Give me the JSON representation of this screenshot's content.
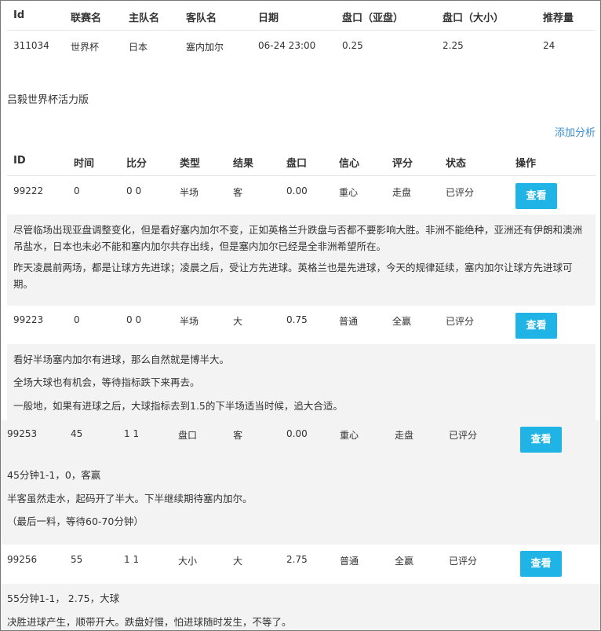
{
  "match_table": {
    "headers": [
      "Id",
      "联赛名",
      "主队名",
      "客队名",
      "日期",
      "盘口（亚盘）",
      "盘口（大小）",
      "推荐量"
    ],
    "row": [
      "311034",
      "世界杯",
      "日本",
      "塞内加尔",
      "06-24 23:00",
      "0.25",
      "2.25",
      "24"
    ]
  },
  "section_title": "吕毅世界杯活力版",
  "add_analysis": "添加分析",
  "analysis_table": {
    "headers": [
      "ID",
      "时间",
      "比分",
      "类型",
      "结果",
      "盘口",
      "信心",
      "评分",
      "状态",
      "操作"
    ],
    "rows": [
      {
        "cells": [
          "99222",
          "0",
          "0 0",
          "半场",
          "客",
          "0.00",
          "重心",
          "走盘",
          "已评分"
        ],
        "button": "查看",
        "paragraphs": [
          "尽管临场出现亚盘调整变化，但是看好塞内加尔不变，正如英格兰升跌盘与否都不要影响大胜。非洲不能绝种，亚洲还有伊朗和澳洲吊盐水，日本也未必不能和塞内加尔共存出线，但是塞内加尔已经是全非洲希望所在。",
          "昨天凌晨前两场，都是让球方先进球；凌晨之后，受让方先进球。英格兰也是先进球，今天的规律延续，塞内加尔让球方先进球可期。"
        ]
      },
      {
        "cells": [
          "99223",
          "0",
          "0 0",
          "半场",
          "大",
          "0.75",
          "普通",
          "全赢",
          "已评分"
        ],
        "button": "查看",
        "paragraphs": [
          "看好半场塞内加尔有进球，那么自然就是博半大。",
          "全场大球也有机会，等待指标跌下来再去。",
          "一般地，如果有进球之后，大球指标去到1.5的下半场适当时候，追大合适。"
        ]
      },
      {
        "cells": [
          "99253",
          "45",
          "1 1",
          "盘口",
          "客",
          "0.00",
          "重心",
          "走盘",
          "已评分"
        ],
        "button": "查看",
        "paragraphs": [
          "45分钟1-1，0，客赢",
          "半客虽然走水，起码开了半大。下半继续期待塞内加尔。",
          "（最后一料，等待60-70分钟）"
        ]
      },
      {
        "cells": [
          "99256",
          "55",
          "1 1",
          "大小",
          "大",
          "2.75",
          "普通",
          "全赢",
          "已评分"
        ],
        "button": "查看",
        "paragraphs": [
          "55分钟1-1， 2.75，大球",
          "决胜进球产生，顺带开大。跌盘好慢，怕进球随时发生，不等了。"
        ]
      }
    ]
  }
}
